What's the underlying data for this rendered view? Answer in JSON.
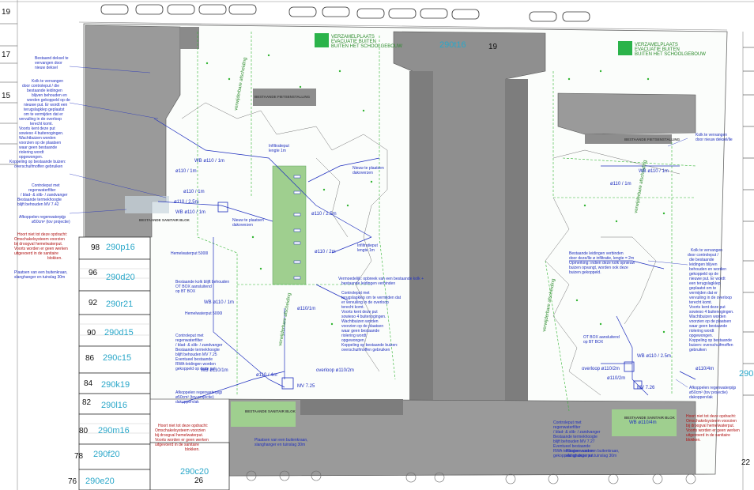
{
  "colors": {
    "roof": "#9a9a9a",
    "roof_dark": "#7d7d7d",
    "grass": "#9fcf8f",
    "pipe": "#1f2fbf",
    "survey": "#33b533",
    "parcel_id": "#2aa7c9",
    "red_note": "#b01010"
  },
  "top_labels": {
    "parcel_center": "290t16",
    "number_center": "19",
    "evac_left": [
      "VERZAMELPLAATS",
      "EVACUATIE BUITEN",
      "BUITEN HET SCHOOLGEBOUW"
    ],
    "evac_right": [
      "VERZAMELPLAATS",
      "EVACUATIE BUITEN",
      "BUITEN HET SCHOOLGEBOUW"
    ]
  },
  "left_edge_numbers": [
    "19",
    "17",
    "15"
  ],
  "house_rows": [
    {
      "no": "98",
      "parcel": "290p16"
    },
    {
      "no": "96",
      "parcel": "290d20"
    },
    {
      "no": "92",
      "parcel": "290r21"
    },
    {
      "no": "90",
      "parcel": "290d15"
    },
    {
      "no": "86",
      "parcel": "290c15"
    },
    {
      "no": "84",
      "parcel": "290k19"
    },
    {
      "no": "82",
      "parcel": "290l16"
    },
    {
      "no": "80",
      "parcel": "290m16"
    },
    {
      "no": "78",
      "parcel": "290f20"
    },
    {
      "no": "76",
      "parcel": "290e20"
    }
  ],
  "bottom_labels": {
    "parcel": "290c20",
    "number": "26"
  },
  "right_labels": {
    "parcel": "290a",
    "number": "22"
  },
  "left_notes": [
    "Bestaand deksel te vervangen door nieuw deksel",
    "Kolk te vervangen door controleput / die bestaande leidingen blijven behouden en worden gekoppeld op de nieuwe put. Er wordt een terugslagklep geplaatst om te vermijden dat er vervuiling in de overloop terecht komt.",
    "Voorts kent deze put sowieso 4 buitenogingen. Wachtbuizen worden voorzien op de plaatsen waar geen bestaande riolering wordt opgewongen.",
    "Koppeling op bestaande buizen: overschuifmoffen gebruiken",
    "Controleput met regenwaterfilter / blad- & slib- / zandvanger Bestaande termekhoogte blijft behouden MV 7.42",
    "Afkoppelen regenwaterpijp ø50cm² (tov projectie)"
  ],
  "red_notes": [
    "Hoort niet tot deze opdracht: Omschakelsysteem voorzien bij droogval hemelwaterput. Voorts worden er geen werken uitgevoerd in de sanitaire blokken."
  ],
  "center_notes": [
    "Infiltratieput lengte 1m",
    "Nieuw te plaatsen dakoverzen",
    "Nieuw te plaatsen dakoverzen",
    "Infiltratieput lengte 1m",
    "Hemelwaterput 5000l",
    "Bestaande kolk blijft behouden OT BOX aansluitend op BT BOX",
    "Hemelwaterput 5000l",
    "Controleput met regenwaterfilter / blad- & slib- / zandvanger Bestaande termekhoogte blijft behouden MV 7.25 Eventueel bestaande RWA-leidingen worden gekoppeld op deze put.",
    "Afkoppelen regenwaterpijp ø50cm² (tov projectie) dakoppervlak",
    "Vermoedelijk: opbreek van een bestaande kolk + bestaande leidingen verbinden",
    "Controleput met terugslagklep om te vermijden dat er vervuiling in de overloop terecht komt. Voorts kent deze put sowieso 4 buitenogingen. Wachtbuizen worden voorzien op de plaatsen waar geen bestaande riolering wordt opgewongen. Koppeling op bestaande buizen: overschuifmoffen gebruiken",
    "Plaatsen van een buitenkraan, slanghanger en tuinslag 30m",
    "Hoort niet tot deze opdracht: Omschakelsysteem voorzien bij droogval hemelwaterput. Voorts worden er geen werken uitgevoerd in de sanitaire blokken."
  ],
  "right_notes": [
    "Kolk te vervangen door nieuw deksel/lle",
    "Bestaande leidingen verbinden door deze/lle ø infiltratie, lengte = 2m. Opmerking: indien deze kolk opnieuw buizen opvangt, worden ook deze buizen gekoppeld.",
    "Kolk te vervangen door controleput / die bestaande leidingen blijven behouden en worden gekoppeld op de nieuwe put. Er wordt een terugslagklep geplaatst om te vermijden dat er vervuiling in de overloop terecht komt. Voorts kent deze put sowieso 4 buitenogingen. Wachtbuizen worden voorzien op de plaatsen waar geen bestaande riolering wordt opgewongen. Koppeling op bestaande buizen: overschuifmoffen gebruiken",
    "Afkoppelen regenwaterpijp ø50cm² (tov projectie) dakoppervlak",
    "Hoort niet tot deze opdracht: Omschakelsysteem voorzien bij droogval hemelwaterput. Voorts worden er geen werken uitgevoerd in de sanitaire blokken.",
    "OT BOX aansluitend op BT BOX",
    "Controleput met regenwaterfilter / blad- & slib- / zandvanger Bestaande termekhoogte blijft behouden MV 7.27 Eventueel bestaande RWA-leidingen worden gekoppeld op deze put.",
    "Plaatsen van een buitenkraan, slanghanger en tuinslag 30m"
  ],
  "pipe_labels": [
    "WB ø110 / 1m",
    "ø110 / 1m",
    "ø110 / 1m",
    "ø110 / 2.5m",
    "ø110 / 2.5m",
    "WB ø110 / 1m",
    "ø110 / 2m",
    "WB ø110 / 1m",
    "ø110 / 4m",
    "overloop ø110/2m",
    "WB ø110/1m",
    "ø110/1m",
    "WB ø110 / 1m",
    "ø110 / 1m",
    "WB ø110 / 2.5m",
    "ø110/2m",
    "overloop ø110/2m",
    "ø110/4m",
    "WB ø110/4m"
  ],
  "mv_labels": [
    "MV 7.25",
    "MV 7.26"
  ],
  "green_labels": [
    "verwijderbare afscheiding",
    "verwijderbare afscheiding",
    "verwijderbare afscheiding",
    "verwijderbare afscheiding"
  ],
  "building_labels": [
    "BESTAANDE FIETSENSTALLING",
    "BESTAANDE FIETSENSTALLING",
    "BESTAANDE SANITAIR BLOK",
    "BESTAANDE SANITAIR BLOK",
    "BESTAANDE SANITAIR BLOK"
  ]
}
